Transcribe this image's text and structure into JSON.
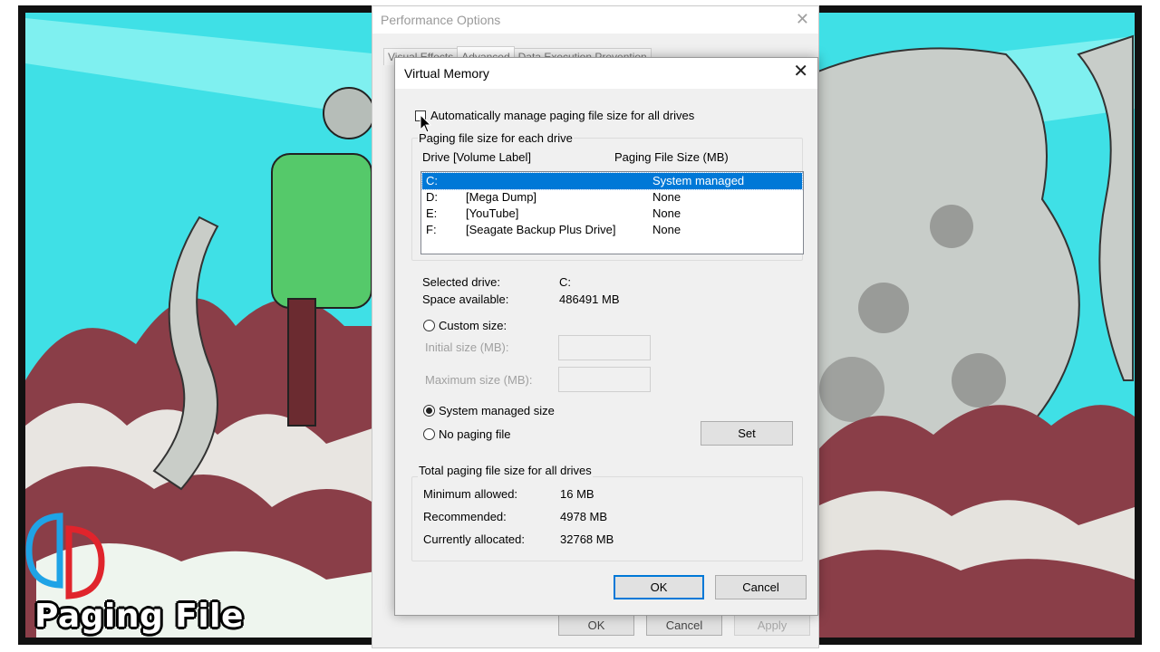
{
  "overlay": {
    "caption": "Paging File"
  },
  "performance_options": {
    "title": "Performance Options",
    "tabs": [
      "Visual Effects",
      "Advanced",
      "Data Execution Prevention"
    ],
    "active_tab": "Advanced",
    "buttons": {
      "ok": "OK",
      "cancel": "Cancel",
      "apply": "Apply"
    }
  },
  "virtual_memory": {
    "title": "Virtual Memory",
    "auto_manage_label": "Automatically manage paging file size for all drives",
    "auto_manage_checked": false,
    "paging_group_label": "Paging file size for each drive",
    "columns": {
      "drive": "Drive  [Volume Label]",
      "size": "Paging File Size (MB)"
    },
    "drives": [
      {
        "letter": "C:",
        "label": "",
        "size": "System managed",
        "selected": true
      },
      {
        "letter": "D:",
        "label": "[Mega Dump]",
        "size": "None",
        "selected": false
      },
      {
        "letter": "E:",
        "label": "[YouTube]",
        "size": "None",
        "selected": false
      },
      {
        "letter": "F:",
        "label": "[Seagate Backup Plus Drive]",
        "size": "None",
        "selected": false
      }
    ],
    "selected_drive_label": "Selected drive:",
    "selected_drive_value": "C:",
    "space_available_label": "Space available:",
    "space_available_value": "486491 MB",
    "custom_size_label": "Custom size:",
    "initial_size_label": "Initial size (MB):",
    "maximum_size_label": "Maximum size (MB):",
    "initial_size_value": "",
    "maximum_size_value": "",
    "system_managed_label": "System managed size",
    "no_paging_label": "No paging file",
    "selected_option": "System managed size",
    "set_button": "Set",
    "totals_group_label": "Total paging file size for all drives",
    "minimum_label": "Minimum allowed:",
    "minimum_value": "16 MB",
    "recommended_label": "Recommended:",
    "recommended_value": "4978 MB",
    "allocated_label": "Currently allocated:",
    "allocated_value": "32768 MB",
    "ok_button": "OK",
    "cancel_button": "Cancel"
  },
  "colors": {
    "selection": "#0078d7",
    "dialog_bg": "#f0f0f0",
    "wallpaper_sky": "#3fe0e6",
    "wallpaper_wave": "#8a3e48",
    "wallpaper_border": "#111111"
  }
}
